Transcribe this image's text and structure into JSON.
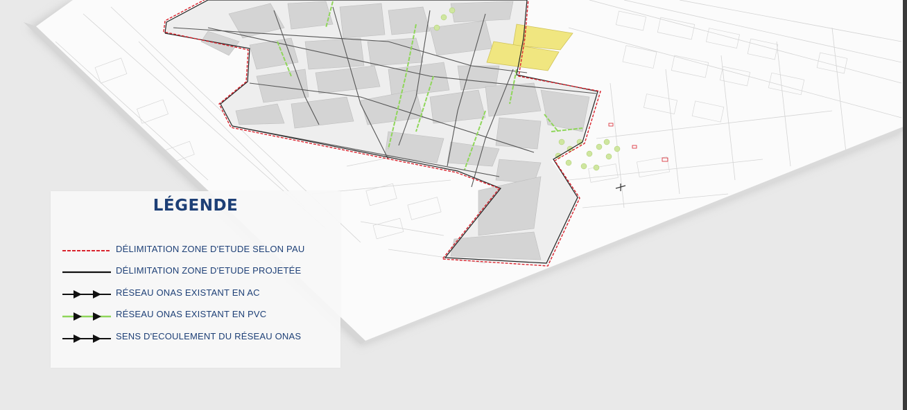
{
  "legend": {
    "title": "LÉGENDE",
    "items": [
      {
        "label": "DÉLIMITATION ZONE D'ETUDE SELON PAU",
        "symbol": "red-dashed-line",
        "color": "#d9232d"
      },
      {
        "label": "DÉLIMITATION ZONE D'ETUDE PROJETÉE",
        "symbol": "black-solid-line",
        "color": "#111111"
      },
      {
        "label": "RÉSEAU ONAS EXISTANT EN AC",
        "symbol": "black-line-arrows",
        "color": "#111111"
      },
      {
        "label": "RÉSEAU ONAS EXISTANT EN PVC",
        "symbol": "green-line-black-arrows",
        "color": "#8fd65a"
      },
      {
        "label": "SENS D'ECOULEMENT DU RÉSEAU ONAS",
        "symbol": "flow-direction-arrows",
        "color": "#111111"
      }
    ]
  },
  "colors": {
    "background": "#e9e9e9",
    "sheet": "#fbfbfb",
    "block_fill": "#d4d4d4",
    "zone_boundary": "#d9232d",
    "pvc_network": "#8fd65a",
    "highlight_parcel": "#f0e680",
    "legend_text": "#1d3f76"
  }
}
